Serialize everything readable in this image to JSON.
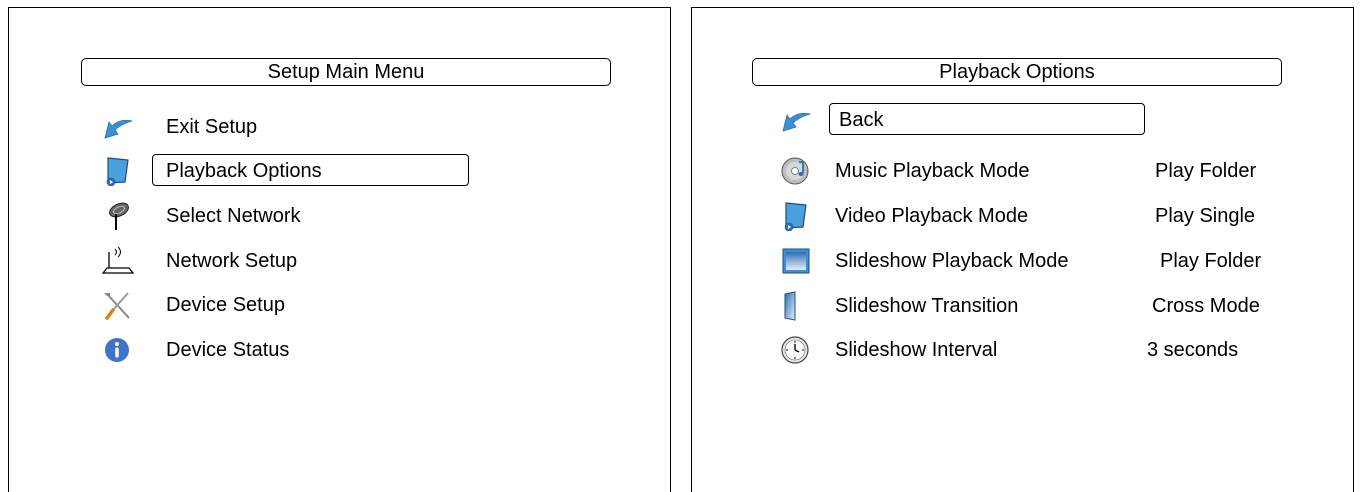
{
  "left_panel": {
    "title": "Setup Main Menu",
    "items": [
      {
        "label": "Exit Setup",
        "icon": "back-arrow-icon"
      },
      {
        "label": "Playback Options",
        "icon": "video-playback-icon",
        "selected": true
      },
      {
        "label": "Select Network",
        "icon": "antenna-icon"
      },
      {
        "label": "Network Setup",
        "icon": "router-icon"
      },
      {
        "label": "Device Setup",
        "icon": "tools-icon"
      },
      {
        "label": "Device Status",
        "icon": "info-icon"
      }
    ]
  },
  "right_panel": {
    "title": "Playback Options",
    "items": [
      {
        "label": "Back",
        "value": "",
        "icon": "back-arrow-icon",
        "selected": true
      },
      {
        "label": "Music Playback Mode",
        "value": "Play Folder",
        "icon": "music-disc-icon"
      },
      {
        "label": "Video Playback Mode",
        "value": "Play Single",
        "icon": "video-playback-icon"
      },
      {
        "label": "Slideshow Playback Mode",
        "value": "Play Folder",
        "icon": "slideshow-icon"
      },
      {
        "label": "Slideshow Transition",
        "value": "Cross Mode",
        "icon": "transition-icon"
      },
      {
        "label": "Slideshow Interval",
        "value": "3 seconds",
        "icon": "clock-icon"
      }
    ]
  },
  "colors": {
    "accent_blue": "#3d8fd6",
    "info_blue": "#3f72c8",
    "border": "#000000"
  }
}
